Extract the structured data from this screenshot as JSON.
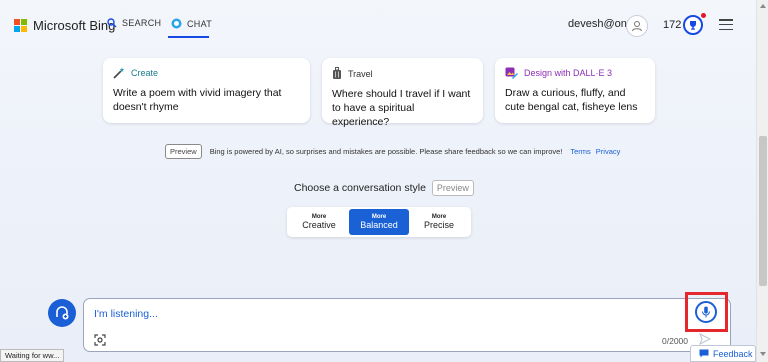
{
  "header": {
    "logo_text": "Microsoft Bing",
    "tabs": [
      {
        "label": "SEARCH",
        "icon": "search-icon"
      },
      {
        "label": "CHAT",
        "icon": "chat-bubble-icon",
        "active": true
      }
    ],
    "user_name": "devesh@on...",
    "reward_points": "172"
  },
  "suggestions": [
    {
      "category": "Create",
      "icon": "magic-wand-icon",
      "color": "#1b7a8c",
      "text": "Write a poem with vivid imagery that doesn't rhyme"
    },
    {
      "category": "Travel",
      "icon": "luggage-icon",
      "color": "#333333",
      "text": "Where should I travel if I want to have a spiritual experience?"
    },
    {
      "category": "Design with DALL·E 3",
      "icon": "image-create-icon",
      "color": "#8c2fb5",
      "text": "Draw a curious, fluffy, and cute bengal cat, fisheye lens"
    }
  ],
  "disclaimer": {
    "badge": "Preview",
    "text": "Bing is powered by AI, so surprises and mistakes are possible. Please share feedback so we can improve!",
    "terms_label": "Terms",
    "privacy_label": "Privacy"
  },
  "conversation_style": {
    "title": "Choose a conversation style",
    "badge": "Preview",
    "options": [
      {
        "more": "More",
        "name": "Creative"
      },
      {
        "more": "More",
        "name": "Balanced",
        "active": true
      },
      {
        "more": "More",
        "name": "Precise"
      }
    ]
  },
  "composer": {
    "value": "I'm listening...",
    "counter": "0/2000"
  },
  "status_bar": {
    "text": "Waiting for ww..."
  },
  "feedback_label": "Feedback",
  "colors": {
    "accent": "#1b5fd6",
    "highlight": "#e4262d"
  }
}
